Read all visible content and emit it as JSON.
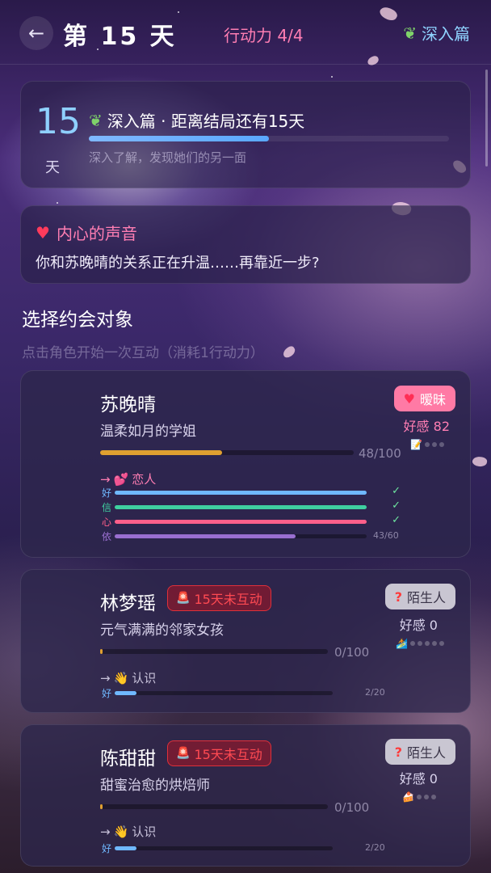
{
  "header": {
    "back_icon": "back-arrow-icon",
    "title": "第 15 天",
    "energy": "行动力 4/4",
    "chapter": "深入篇",
    "chapter_icon": "leaf-icon"
  },
  "day_card": {
    "day": "15",
    "unit": "天",
    "heading": "深入篇 · 距离结局还有15天",
    "progress": 0.5,
    "subtitle": "深入了解，发现她们的另一面",
    "bar_color": "#6aaeff"
  },
  "voice": {
    "title": "内心的声音",
    "text": "你和苏晚晴的关系正在升温……再靠近一步?"
  },
  "section": {
    "title": "选择约会对象",
    "subtitle": "点击角色开始一次互动（消耗1行动力）"
  },
  "characters": [
    {
      "name": "苏晚晴",
      "desc": "温柔如月的学姐",
      "status": "暧昧",
      "status_icon": "heart-icon",
      "favor": "好感 82",
      "favor_color": "#ff7eb3",
      "progress_label": "48/100",
      "progress": 0.48,
      "progress_color": "#e0a030",
      "next_stage": "恋人",
      "next_icon": "couple-hearts-icon",
      "next_color": "#ff7eb3",
      "stats": [
        {
          "key": "好",
          "fill": 1.0,
          "color": "#6fb8ff",
          "done": true
        },
        {
          "key": "信",
          "fill": 1.0,
          "color": "#3fd0a0",
          "done": true
        },
        {
          "key": "心",
          "fill": 1.0,
          "color": "#ff5f8a",
          "done": true
        },
        {
          "key": "依",
          "fill": 0.7167,
          "color": "#9a6fd0",
          "done": false,
          "label": "43/60"
        }
      ]
    },
    {
      "name": "林梦瑶",
      "desc": "元气满满的邻家女孩",
      "alert": "15天未互动",
      "status": "陌生人",
      "favor": "好感 0",
      "progress_label": "0/100",
      "progress": 0.0,
      "progress_color": "#e0a030",
      "next_stage": "认识",
      "next_icon": "wave-hand-icon",
      "stat_key": "好",
      "stat_fill": 0.1,
      "stat_label": "2/20",
      "item_icon": "surf-icon"
    },
    {
      "name": "陈甜甜",
      "desc": "甜蜜治愈的烘焙师",
      "alert": "15天未互动",
      "status": "陌生人",
      "favor": "好感 0",
      "progress_label": "0/100",
      "progress": 0.0,
      "progress_color": "#e0a030",
      "next_stage": "认识",
      "next_icon": "wave-hand-icon",
      "stat_key": "好",
      "stat_fill": 0.1,
      "stat_label": "2/20",
      "item_icon": "cake-icon"
    }
  ]
}
